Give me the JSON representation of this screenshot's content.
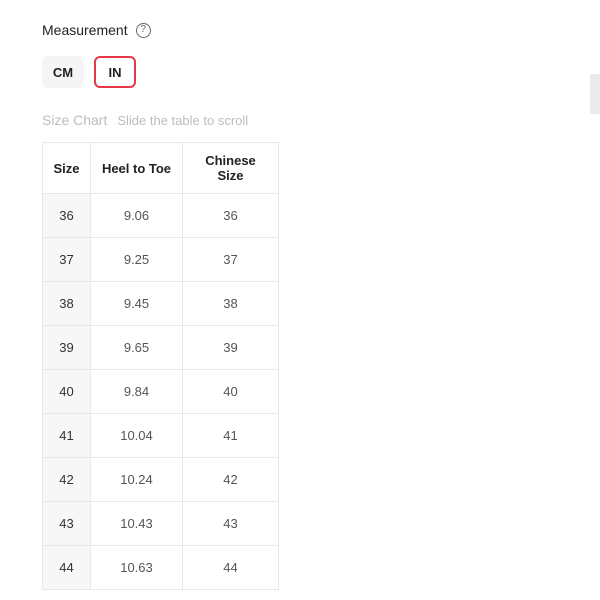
{
  "measurement": {
    "label": "Measurement",
    "help_icon_glyph": "?"
  },
  "units": {
    "cm_label": "CM",
    "in_label": "IN",
    "active": "IN"
  },
  "chart": {
    "title": "Size Chart",
    "hint": "Slide the table to scroll",
    "columns": {
      "size": "Size",
      "heel_to_toe": "Heel to Toe",
      "chinese_size": "Chinese Size"
    },
    "rows": [
      {
        "size": "36",
        "heel_to_toe": "9.06",
        "chinese_size": "36"
      },
      {
        "size": "37",
        "heel_to_toe": "9.25",
        "chinese_size": "37"
      },
      {
        "size": "38",
        "heel_to_toe": "9.45",
        "chinese_size": "38"
      },
      {
        "size": "39",
        "heel_to_toe": "9.65",
        "chinese_size": "39"
      },
      {
        "size": "40",
        "heel_to_toe": "9.84",
        "chinese_size": "40"
      },
      {
        "size": "41",
        "heel_to_toe": "10.04",
        "chinese_size": "41"
      },
      {
        "size": "42",
        "heel_to_toe": "10.24",
        "chinese_size": "42"
      },
      {
        "size": "43",
        "heel_to_toe": "10.43",
        "chinese_size": "43"
      },
      {
        "size": "44",
        "heel_to_toe": "10.63",
        "chinese_size": "44"
      }
    ]
  }
}
